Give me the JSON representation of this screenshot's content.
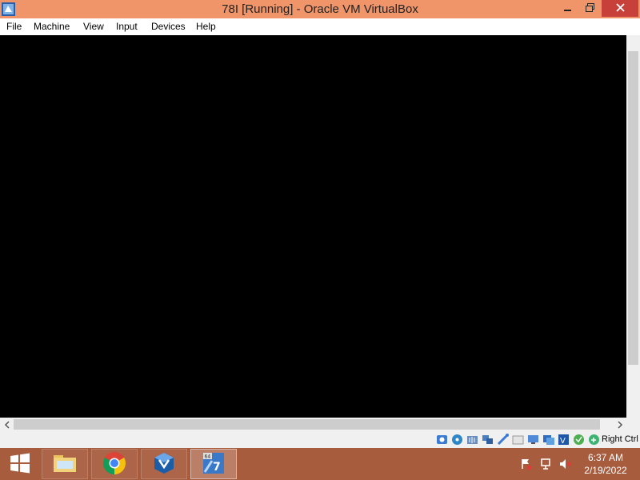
{
  "window": {
    "title": "78I [Running] - Oracle VM VirtualBox",
    "icon": "virtualbox-vm-icon",
    "controls": [
      "minimize-icon",
      "restore-icon",
      "close-icon"
    ]
  },
  "menu": {
    "items": [
      "File",
      "Machine",
      "View",
      "Input",
      "Devices",
      "Help"
    ]
  },
  "status_bar": {
    "icons": [
      "hard-disk-icon",
      "optical-drive-icon",
      "audio-icon",
      "network-icon",
      "usb-icon",
      "shared-folders-icon",
      "display-icon",
      "video-capture-icon",
      "virtualization-icon",
      "mouse-integration-icon",
      "keyboard-capture-icon"
    ],
    "host_key": "Right Ctrl"
  },
  "taskbar": {
    "start_icon": "windows-start-icon",
    "pinned": [
      {
        "name": "file-explorer",
        "icon": "folder-icon"
      },
      {
        "name": "chrome",
        "icon": "chrome-icon"
      },
      {
        "name": "virtualbox-manager",
        "icon": "virtualbox-icon"
      },
      {
        "name": "vm-78i",
        "icon": "windows7-64-vm-icon",
        "active": true
      }
    ],
    "tray_icons": [
      "action-center-flag-icon",
      "network-icon",
      "volume-muted-icon"
    ],
    "clock": {
      "time": "6:37 AM",
      "date": "2/19/2022"
    }
  },
  "colors": {
    "titlebar": "#f0946a",
    "taskbar": "#a85c3e",
    "close_button": "#c7413a",
    "vm_screen": "#000000"
  }
}
